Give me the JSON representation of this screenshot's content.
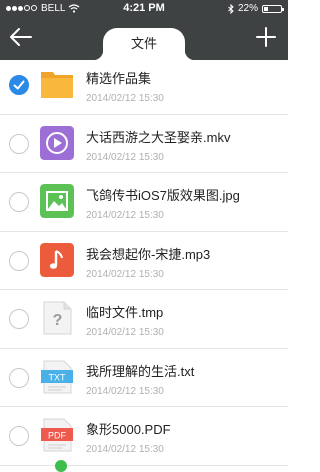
{
  "status": {
    "carrier": "BELL",
    "time": "4:21 PM",
    "battery": "22%"
  },
  "header": {
    "title": "文件"
  },
  "files": [
    {
      "name": "精选作品集",
      "date": "2014/02/12 15:30",
      "type": "folder-icon",
      "checked": true
    },
    {
      "name": "大话西游之大圣娶亲.mkv",
      "date": "2014/02/12 15:30",
      "type": "video-file-icon",
      "checked": false
    },
    {
      "name": "飞鸽传书iOS7版效果图.jpg",
      "date": "2014/02/12 15:30",
      "type": "image-file-icon",
      "checked": false
    },
    {
      "name": "我会想起你-宋捷.mp3",
      "date": "2014/02/12 15:30",
      "type": "audio-file-icon",
      "checked": false
    },
    {
      "name": "临时文件.tmp",
      "date": "2014/02/12 15:30",
      "type": "unknown-file-icon",
      "checked": false
    },
    {
      "name": "我所理解的生活.txt",
      "date": "2014/02/12 15:30",
      "type": "text-file-icon",
      "checked": false
    },
    {
      "name": "象形5000.PDF",
      "date": "2014/02/12 15:30",
      "type": "pdf-file-icon",
      "checked": false
    }
  ],
  "icon_labels": {
    "txt": "TXT",
    "pdf": "PDF",
    "unknown": "?"
  },
  "colors": {
    "header": "#3e4243",
    "accent": "#2a8ae6",
    "folder": "#f9b73b",
    "video": "#9d6fd6",
    "image": "#5cc255",
    "audio": "#ec5b3b"
  }
}
